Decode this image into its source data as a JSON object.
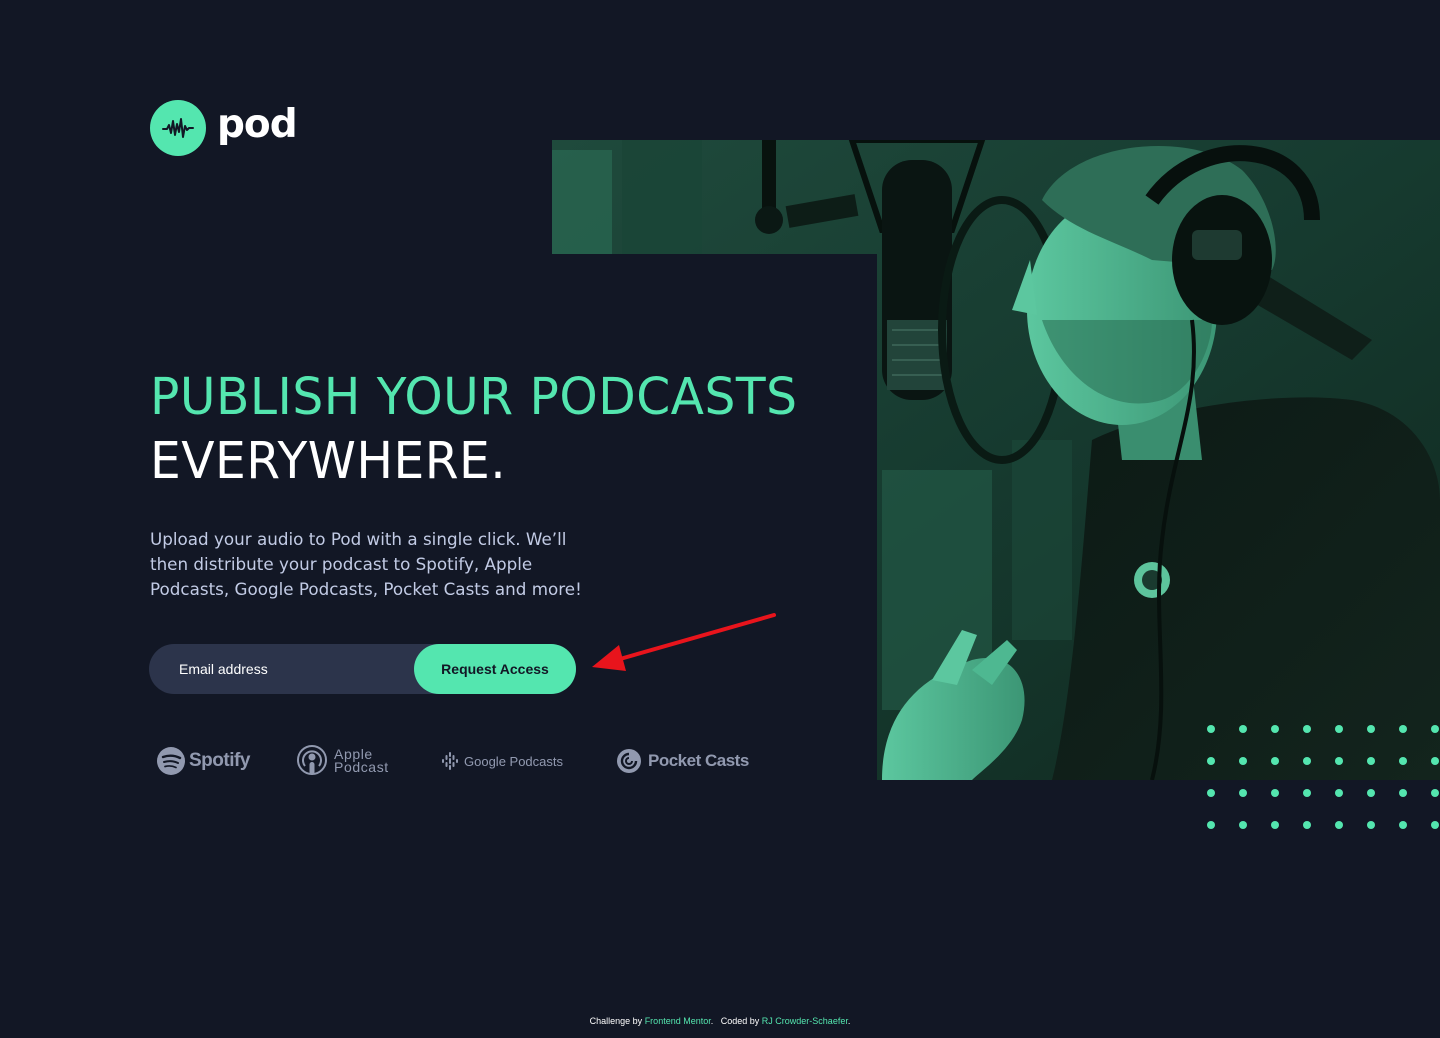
{
  "brand": {
    "name": "pod",
    "logo_icon": "sound-wave-icon",
    "accent_color": "#54e6af",
    "background_color": "#121725"
  },
  "hero": {
    "headline_line1": "PUBLISH YOUR PODCASTS",
    "headline_line2": "EVERYWHERE.",
    "description": "Upload your audio to Pod with a single click. We’ll then distribute your podcast to Spotify, Apple Podcasts, Google Podcasts, Pocket Casts and more!",
    "image": "podcaster-with-headphones-at-microphone-photo"
  },
  "form": {
    "email_placeholder": "Email address",
    "submit_label": "Request Access"
  },
  "platforms": {
    "spotify": "Spotify",
    "apple": "Apple\nPodcast",
    "google": "Google Podcasts",
    "pocket": "Pocket Casts"
  },
  "footer": {
    "challenge_prefix": "Challenge by",
    "challenge_link": "Frontend Mentor",
    "coded_prefix": "Coded by",
    "coded_link": "RJ Crowder-Schaefer"
  }
}
